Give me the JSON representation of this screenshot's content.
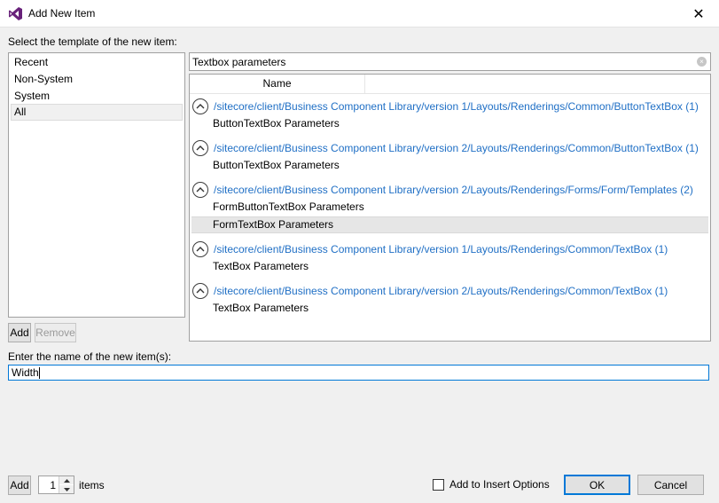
{
  "window": {
    "title": "Add New Item",
    "close_glyph": "✕",
    "icon": "visual-studio-icon"
  },
  "template_label": "Select the template of the new item:",
  "templates": [
    {
      "label": "Recent"
    },
    {
      "label": "Non-System"
    },
    {
      "label": "System"
    },
    {
      "label": "All",
      "selected": true
    }
  ],
  "template_buttons": {
    "add": "Add",
    "remove": "Remove"
  },
  "search": {
    "value": "Textbox parameters",
    "clear_glyph": "×"
  },
  "results": {
    "column_name": "Name",
    "groups": [
      {
        "path": "/sitecore/client/Business Component Library/version 1/Layouts/Renderings/Common/ButtonTextBox (1)",
        "items": [
          "ButtonTextBox Parameters"
        ]
      },
      {
        "path": "/sitecore/client/Business Component Library/version 2/Layouts/Renderings/Common/ButtonTextBox (1)",
        "items": [
          "ButtonTextBox Parameters"
        ]
      },
      {
        "path": "/sitecore/client/Business Component Library/version 2/Layouts/Renderings/Forms/Form/Templates (2)",
        "items": [
          "FormButtonTextBox Parameters",
          "FormTextBox Parameters"
        ]
      },
      {
        "path": "/sitecore/client/Business Component Library/version 1/Layouts/Renderings/Common/TextBox (1)",
        "items": [
          "TextBox Parameters"
        ]
      },
      {
        "path": "/sitecore/client/Business Component Library/version 2/Layouts/Renderings/Common/TextBox (1)",
        "items": [
          "TextBox Parameters"
        ]
      }
    ],
    "selected_item": "FormTextBox Parameters"
  },
  "name_label": "Enter the name of the new item(s):",
  "name_input": {
    "value": "Width"
  },
  "footer": {
    "add": "Add",
    "count": "1",
    "items_label": "items",
    "insert_options_label": "Add to Insert Options",
    "insert_options_checked": false,
    "ok": "OK",
    "cancel": "Cancel"
  },
  "colors": {
    "link": "#1f6fc5",
    "focus": "#0078d7",
    "vs_icon": "#68217a"
  }
}
